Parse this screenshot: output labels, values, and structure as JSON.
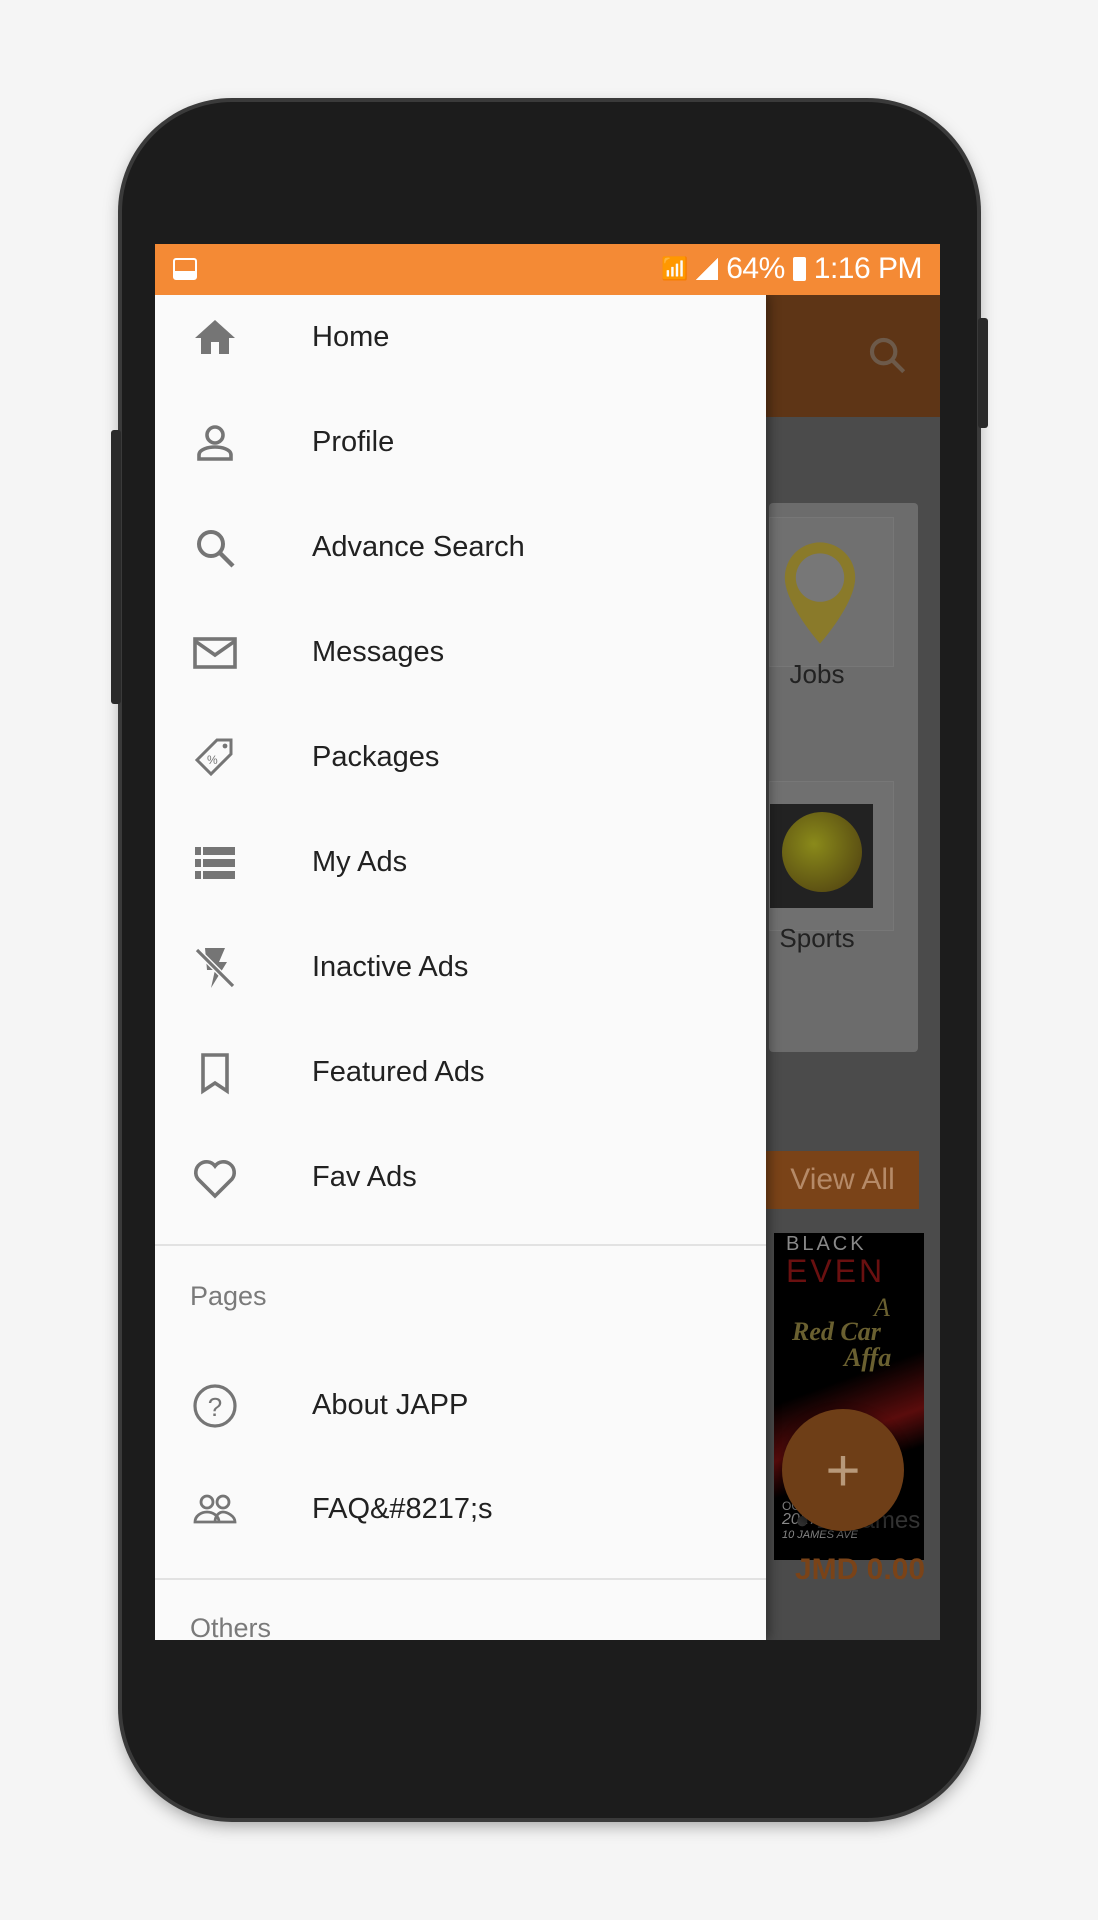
{
  "status_bar": {
    "battery": "64%",
    "time": "1:16 PM",
    "color": "#f48a35"
  },
  "drawer": {
    "items": [
      {
        "label": "Home",
        "icon": "home-icon"
      },
      {
        "label": "Profile",
        "icon": "person-icon"
      },
      {
        "label": "Advance Search",
        "icon": "search-icon"
      },
      {
        "label": "Messages",
        "icon": "mail-icon"
      },
      {
        "label": "Packages",
        "icon": "tag-icon"
      },
      {
        "label": "My Ads",
        "icon": "list-icon"
      },
      {
        "label": "Inactive Ads",
        "icon": "flash-off-icon"
      },
      {
        "label": "Featured Ads",
        "icon": "bookmark-icon"
      },
      {
        "label": "Fav Ads",
        "icon": "heart-icon"
      }
    ],
    "pages_header": "Pages",
    "pages": [
      {
        "label": "About JAPP",
        "icon": "help-icon"
      },
      {
        "label": "FAQ&#8217;s",
        "icon": "people-icon"
      }
    ],
    "others_header": "Others"
  },
  "background": {
    "categories": [
      "Jobs",
      "Sports"
    ],
    "view_all": "View All",
    "poster_text": [
      "BLACK",
      "EVEN",
      "A",
      "Red Car",
      "Affa",
      "OCT,30th",
      "2017",
      "10 JAMES AVE"
    ],
    "location": "10 James",
    "price": "JMD 0.00",
    "fab": "+",
    "accent": "#f48a35"
  }
}
